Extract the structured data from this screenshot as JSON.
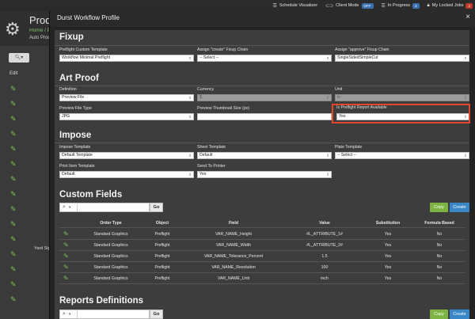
{
  "topbar": {
    "schedule_visualizer": "Schedule Visualizer",
    "client_mode": "Client Mode",
    "client_mode_state": "OFF",
    "in_progress": "In Progress",
    "in_progress_count": "3",
    "locked_jobs": "My Locked Jobs",
    "locked_jobs_count": "2"
  },
  "background": {
    "title": "Produ",
    "breadcrumb": "Home / P",
    "subtitle": "Auto Proce",
    "edit_header": "Edit",
    "yard_sign": "Yard Sign"
  },
  "modal": {
    "title": "Durst Workflow Profile",
    "close_glyph": "×"
  },
  "fixup": {
    "title": "Fixup",
    "preflight_template_label": "Preflight Custom Template",
    "preflight_template_value": "Workflow Minimal Preflight",
    "create_chain_label": "Assign \"create\" Fixup Chain",
    "create_chain_value": "-- Select --",
    "approve_chain_label": "Assign \"approve\" Fixup Chain",
    "approve_chain_value": "SingleSidedSimpleCut"
  },
  "art_proof": {
    "title": "Art Proof",
    "definition_label": "Definition",
    "definition_value": "Preview File",
    "currency_label": "Currency",
    "currency_value": "$",
    "unit_label": "Unit",
    "unit_value": "in",
    "preview_file_type_label": "Preview File Type",
    "preview_file_type_value": "JPG",
    "thumbnail_size_label": "Preview Thumbnail Size (px)",
    "thumbnail_size_value": "",
    "preflight_report_label": "Is Preflight Report Available",
    "preflight_report_value": "Yes"
  },
  "impose": {
    "title": "Impose",
    "impose_template_label": "Impose Template",
    "impose_template_value": "Default Template",
    "sheet_template_label": "Sheet Template",
    "sheet_template_value": "Default",
    "plate_template_label": "Plate Template",
    "plate_template_value": "-- Select --",
    "print_item_template_label": "Print Item Template",
    "print_item_template_value": "Default",
    "send_to_printer_label": "Send To Printer",
    "send_to_printer_value": "Yes"
  },
  "custom_fields": {
    "title": "Custom Fields",
    "go_label": "Go",
    "copy_label": "Copy",
    "create_label": "Create",
    "columns": [
      "Order Type",
      "Object",
      "Field",
      "Value",
      "Substitution",
      "Formula Based"
    ],
    "rows": [
      [
        "Standard Graphics",
        "Preflight",
        "VAR_NAME_Height",
        "#L_ATTRIBUTE_1#",
        "Yes",
        "No"
      ],
      [
        "Standard Graphics",
        "Preflight",
        "VAR_NAME_Width",
        "#L_ATTRIBUTE_2#",
        "Yes",
        "No"
      ],
      [
        "Standard Graphics",
        "Preflight",
        "VAR_NAME_Tolerance_Percent",
        "1.5",
        "Yes",
        "No"
      ],
      [
        "Standard Graphics",
        "Preflight",
        "VAR_NAME_Resolution",
        "100",
        "Yes",
        "No"
      ],
      [
        "Standard Graphics",
        "Preflight",
        "VAR_NAME_Unit",
        "inch",
        "Yes",
        "No"
      ]
    ]
  },
  "reports_definitions": {
    "title": "Reports Definitions",
    "go_label": "Go",
    "copy_label": "Copy",
    "create_label": "Create"
  },
  "colors": {
    "accent_green": "#7cb342",
    "accent_blue": "#3a87c8",
    "highlight_red": "#e2462e"
  }
}
